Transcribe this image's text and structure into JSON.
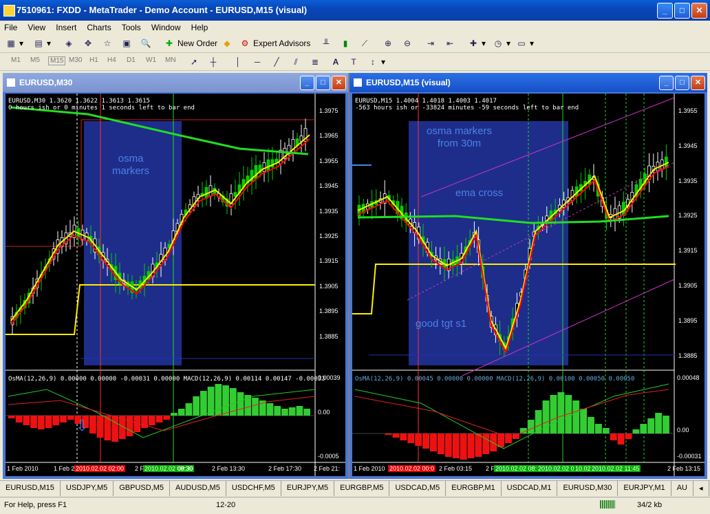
{
  "window": {
    "title": "7510961: FXDD - MetaTrader - Demo Account - EURUSD,M15 (visual)"
  },
  "menu": [
    "File",
    "View",
    "Insert",
    "Charts",
    "Tools",
    "Window",
    "Help"
  ],
  "toolbar": {
    "new_order": "New Order",
    "expert_advisors": "Expert Advisors"
  },
  "timeframes": [
    "M1",
    "M5",
    "M15",
    "M30",
    "H1",
    "H4",
    "D1",
    "W1",
    "MN"
  ],
  "left_chart": {
    "title": "EURUSD,M30",
    "header1": "EURUSD,M30  1.3620 1.3622 1.3613 1.3615",
    "header2": "0 hours ish or 0 minutes 1 seconds left to bar end",
    "price_ticks": [
      "1.3975",
      "1.3965",
      "1.3955",
      "1.3945",
      "1.3935",
      "1.3925",
      "1.3915",
      "1.3905",
      "1.3895",
      "1.3885"
    ],
    "indicator_header": "OsMA(12,26,9) 0.00000 0.00000 -0.00031 0.00000  MACD(12,26,9) 0.00114 0.00147 -0.00033",
    "ind_ticks": [
      "0.00039",
      "0.00",
      "-0.0005"
    ],
    "xticks": [
      "1 Feb 2010",
      "1 Feb 2",
      "2010.02.02 02:00",
      "2 F",
      "2010.02.02 08:30",
      "09:30",
      "2 Feb 13:30",
      "2 Feb 17:30",
      "2 Feb 21:"
    ],
    "annotations": {
      "osma": "osma\nmarkers"
    }
  },
  "right_chart": {
    "title": "EURUSD,M15 (visual)",
    "header1": "EURUSD,M15  1.4004 1.4018 1.4003 1.4017",
    "header2": "-563 hours ish or -33824 minutes -59 seconds left to bar end",
    "price_ticks": [
      "1.3955",
      "1.3945",
      "1.3935",
      "1.3925",
      "1.3915",
      "1.3905",
      "1.3895",
      "1.3885"
    ],
    "indicator_header": "OsMA(12,26,9) 0.00045 0.00000 0.00000  MACD(12,26,9) 0.00100 0.00050 0.00050",
    "ind_ticks": [
      "0.00048",
      "0.00",
      "-0.00031"
    ],
    "xticks": [
      "1 Feb 2010",
      "2010.02.02 00:0",
      "2 Feb 03:15",
      "2 Fe",
      "2010.02.02 08:30",
      "2010.02.02 08:30",
      "10.02.1",
      "2010.02.02 11:45",
      "2 Feb 13:15"
    ],
    "annotations": {
      "osma": "osma markers\nfrom 30m",
      "ema": "ema cross",
      "tgt": "good tgt s1"
    }
  },
  "tabs": [
    "EURUSD,M15",
    "USDJPY,M5",
    "GBPUSD,M5",
    "AUDUSD,M5",
    "USDCHF,M5",
    "EURJPY,M5",
    "EURGBP,M5",
    "USDCAD,M5",
    "EURGBP,M1",
    "USDCAD,M1",
    "EURUSD,M30",
    "EURJPY,M1",
    "AU"
  ],
  "status": {
    "help": "For Help, press F1",
    "profile": "12-20",
    "traffic": "34/2 kb"
  },
  "colors": {
    "bull": "#00d000",
    "bear": "#ff0000",
    "highlight": "#1e2d8a",
    "accent": "#4a82e6"
  }
}
